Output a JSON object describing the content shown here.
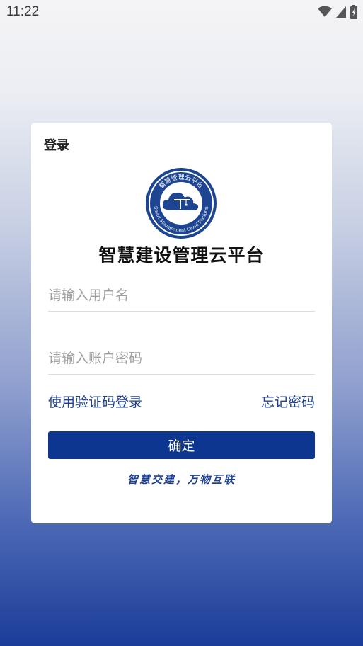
{
  "status_bar": {
    "time": "11:22",
    "icons": [
      "wifi-icon",
      "cellular-signal-icon",
      "battery-icon"
    ]
  },
  "login": {
    "title": "登录",
    "logo": {
      "top_text": "智慧管理云平台",
      "bottom_text": "Smart Management Cloud Platform",
      "icon": "cloud-crane-icon"
    },
    "app_name": "智慧建设管理云平台",
    "username": {
      "value": "",
      "placeholder": "请输入用户名"
    },
    "password": {
      "value": "",
      "placeholder": "请输入账户密码"
    },
    "sms_login_link": "使用验证码登录",
    "forgot_password_link": "忘记密码",
    "confirm_button": "确定",
    "slogan": "智慧交建，万物互联"
  },
  "colors": {
    "primary": "#0d3690",
    "link": "#1e3f8f",
    "background_bottom": "#1b3c98"
  }
}
